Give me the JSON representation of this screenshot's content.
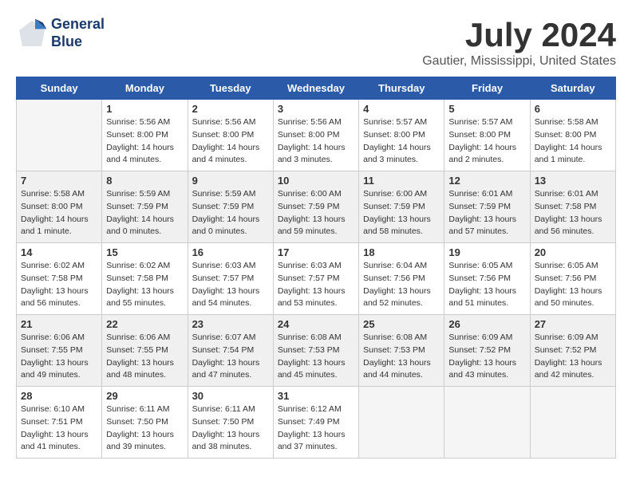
{
  "logo": {
    "line1": "General",
    "line2": "Blue"
  },
  "title": "July 2024",
  "location": "Gautier, Mississippi, United States",
  "days_header": [
    "Sunday",
    "Monday",
    "Tuesday",
    "Wednesday",
    "Thursday",
    "Friday",
    "Saturday"
  ],
  "weeks": [
    [
      {
        "day": "",
        "content": ""
      },
      {
        "day": "1",
        "content": "Sunrise: 5:56 AM\nSunset: 8:00 PM\nDaylight: 14 hours\nand 4 minutes."
      },
      {
        "day": "2",
        "content": "Sunrise: 5:56 AM\nSunset: 8:00 PM\nDaylight: 14 hours\nand 4 minutes."
      },
      {
        "day": "3",
        "content": "Sunrise: 5:56 AM\nSunset: 8:00 PM\nDaylight: 14 hours\nand 3 minutes."
      },
      {
        "day": "4",
        "content": "Sunrise: 5:57 AM\nSunset: 8:00 PM\nDaylight: 14 hours\nand 3 minutes."
      },
      {
        "day": "5",
        "content": "Sunrise: 5:57 AM\nSunset: 8:00 PM\nDaylight: 14 hours\nand 2 minutes."
      },
      {
        "day": "6",
        "content": "Sunrise: 5:58 AM\nSunset: 8:00 PM\nDaylight: 14 hours\nand 1 minute."
      }
    ],
    [
      {
        "day": "7",
        "content": "Sunrise: 5:58 AM\nSunset: 8:00 PM\nDaylight: 14 hours\nand 1 minute."
      },
      {
        "day": "8",
        "content": "Sunrise: 5:59 AM\nSunset: 7:59 PM\nDaylight: 14 hours\nand 0 minutes."
      },
      {
        "day": "9",
        "content": "Sunrise: 5:59 AM\nSunset: 7:59 PM\nDaylight: 14 hours\nand 0 minutes."
      },
      {
        "day": "10",
        "content": "Sunrise: 6:00 AM\nSunset: 7:59 PM\nDaylight: 13 hours\nand 59 minutes."
      },
      {
        "day": "11",
        "content": "Sunrise: 6:00 AM\nSunset: 7:59 PM\nDaylight: 13 hours\nand 58 minutes."
      },
      {
        "day": "12",
        "content": "Sunrise: 6:01 AM\nSunset: 7:59 PM\nDaylight: 13 hours\nand 57 minutes."
      },
      {
        "day": "13",
        "content": "Sunrise: 6:01 AM\nSunset: 7:58 PM\nDaylight: 13 hours\nand 56 minutes."
      }
    ],
    [
      {
        "day": "14",
        "content": "Sunrise: 6:02 AM\nSunset: 7:58 PM\nDaylight: 13 hours\nand 56 minutes."
      },
      {
        "day": "15",
        "content": "Sunrise: 6:02 AM\nSunset: 7:58 PM\nDaylight: 13 hours\nand 55 minutes."
      },
      {
        "day": "16",
        "content": "Sunrise: 6:03 AM\nSunset: 7:57 PM\nDaylight: 13 hours\nand 54 minutes."
      },
      {
        "day": "17",
        "content": "Sunrise: 6:03 AM\nSunset: 7:57 PM\nDaylight: 13 hours\nand 53 minutes."
      },
      {
        "day": "18",
        "content": "Sunrise: 6:04 AM\nSunset: 7:56 PM\nDaylight: 13 hours\nand 52 minutes."
      },
      {
        "day": "19",
        "content": "Sunrise: 6:05 AM\nSunset: 7:56 PM\nDaylight: 13 hours\nand 51 minutes."
      },
      {
        "day": "20",
        "content": "Sunrise: 6:05 AM\nSunset: 7:56 PM\nDaylight: 13 hours\nand 50 minutes."
      }
    ],
    [
      {
        "day": "21",
        "content": "Sunrise: 6:06 AM\nSunset: 7:55 PM\nDaylight: 13 hours\nand 49 minutes."
      },
      {
        "day": "22",
        "content": "Sunrise: 6:06 AM\nSunset: 7:55 PM\nDaylight: 13 hours\nand 48 minutes."
      },
      {
        "day": "23",
        "content": "Sunrise: 6:07 AM\nSunset: 7:54 PM\nDaylight: 13 hours\nand 47 minutes."
      },
      {
        "day": "24",
        "content": "Sunrise: 6:08 AM\nSunset: 7:53 PM\nDaylight: 13 hours\nand 45 minutes."
      },
      {
        "day": "25",
        "content": "Sunrise: 6:08 AM\nSunset: 7:53 PM\nDaylight: 13 hours\nand 44 minutes."
      },
      {
        "day": "26",
        "content": "Sunrise: 6:09 AM\nSunset: 7:52 PM\nDaylight: 13 hours\nand 43 minutes."
      },
      {
        "day": "27",
        "content": "Sunrise: 6:09 AM\nSunset: 7:52 PM\nDaylight: 13 hours\nand 42 minutes."
      }
    ],
    [
      {
        "day": "28",
        "content": "Sunrise: 6:10 AM\nSunset: 7:51 PM\nDaylight: 13 hours\nand 41 minutes."
      },
      {
        "day": "29",
        "content": "Sunrise: 6:11 AM\nSunset: 7:50 PM\nDaylight: 13 hours\nand 39 minutes."
      },
      {
        "day": "30",
        "content": "Sunrise: 6:11 AM\nSunset: 7:50 PM\nDaylight: 13 hours\nand 38 minutes."
      },
      {
        "day": "31",
        "content": "Sunrise: 6:12 AM\nSunset: 7:49 PM\nDaylight: 13 hours\nand 37 minutes."
      },
      {
        "day": "",
        "content": ""
      },
      {
        "day": "",
        "content": ""
      },
      {
        "day": "",
        "content": ""
      }
    ]
  ]
}
